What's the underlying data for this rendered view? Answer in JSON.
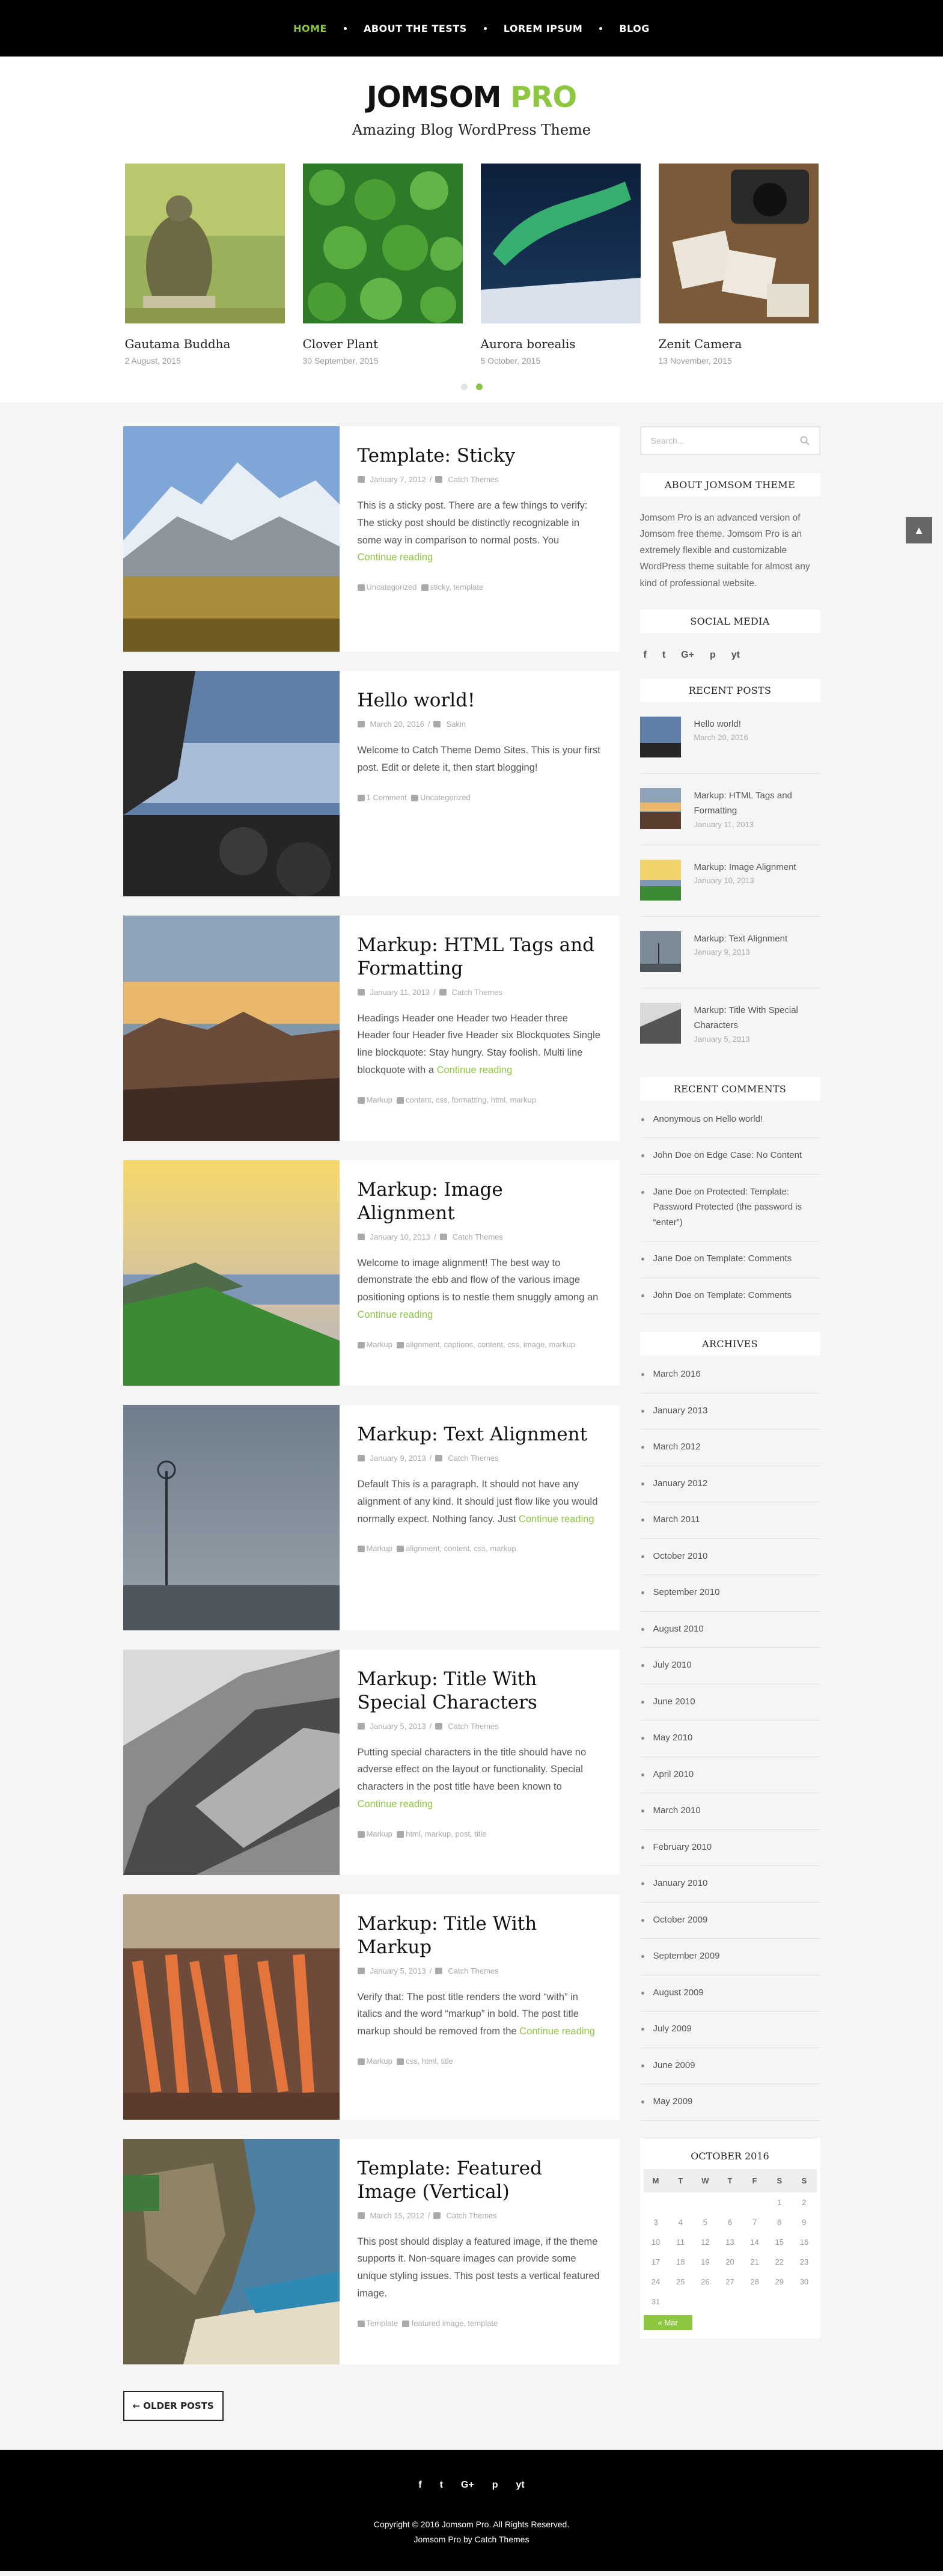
{
  "nav": {
    "items": [
      {
        "label": "HOME",
        "active": true
      },
      {
        "label": "ABOUT THE TESTS"
      },
      {
        "label": "LOREM IPSUM"
      },
      {
        "label": "BLOG"
      }
    ]
  },
  "header": {
    "title_main": "JOMSOM",
    "title_accent": "PRO",
    "description": "Amazing Blog WordPress Theme"
  },
  "featured": [
    {
      "title": "Gautama Buddha",
      "date": "2 August, 2015"
    },
    {
      "title": "Clover Plant",
      "date": "30 September, 2015"
    },
    {
      "title": "Aurora borealis",
      "date": "5 October, 2015"
    },
    {
      "title": "Zenit Camera",
      "date": "13 November, 2015"
    }
  ],
  "posts": [
    {
      "title": "Template: Sticky",
      "date": "January 7, 2012",
      "author": "Catch Themes",
      "excerpt": "This is a sticky post. There are a few things to verify: The sticky post should be distinctly recognizable in some way in comparison to normal posts. You",
      "more": "Continue reading",
      "cats": "Uncategorized",
      "tags": "sticky, template"
    },
    {
      "title": "Hello world!",
      "date": "March 20, 2016",
      "author": "Sakin",
      "excerpt": "Welcome to Catch Theme Demo Sites. This is your first post. Edit or delete it, then start blogging!",
      "more": "",
      "cats": "1 Comment",
      "tags": "Uncategorized"
    },
    {
      "title": "Markup: HTML Tags and Formatting",
      "date": "January 11, 2013",
      "author": "Catch Themes",
      "excerpt": "Headings Header one Header two Header three Header four Header five Header six Blockquotes Single line blockquote: Stay hungry. Stay foolish. Multi line blockquote with a",
      "more": "Continue reading",
      "cats": "Markup",
      "tags": "content, css, formatting, html, markup"
    },
    {
      "title": "Markup: Image Alignment",
      "date": "January 10, 2013",
      "author": "Catch Themes",
      "excerpt": "Welcome to image alignment! The best way to demonstrate the ebb and flow of the various image positioning options is to nestle them snuggly among an",
      "more": "Continue reading",
      "cats": "Markup",
      "tags": "alignment, captions, content, css, image, markup"
    },
    {
      "title": "Markup: Text Alignment",
      "date": "January 9, 2013",
      "author": "Catch Themes",
      "excerpt": "Default This is a paragraph. It should not have any alignment of any kind. It should just flow like you would normally expect. Nothing fancy. Just",
      "more": "Continue reading",
      "cats": "Markup",
      "tags": "alignment, content, css, markup"
    },
    {
      "title": "Markup: Title With Special Characters",
      "date": "January 5, 2013",
      "author": "Catch Themes",
      "excerpt": "Putting special characters in the title should have no adverse effect on the layout or functionality. Special characters in the post title have been known to",
      "more": "Continue reading",
      "cats": "Markup",
      "tags": "html, markup, post, title"
    },
    {
      "title": "Markup: Title With Markup",
      "date": "January 5, 2013",
      "author": "Catch Themes",
      "excerpt": "Verify that: The post title renders the word “with” in italics and the word “markup” in bold. The post title markup should be removed from the",
      "more": "Continue reading",
      "cats": "Markup",
      "tags": "css, html, title"
    },
    {
      "title": "Template: Featured Image (Vertical)",
      "date": "March 15, 2012",
      "author": "Catch Themes",
      "excerpt": "This post should display a featured image, if the theme supports it. Non-square images can provide some unique styling issues. This post tests a vertical featured image.",
      "more": "",
      "cats": "Template",
      "tags": "featured image, template"
    }
  ],
  "older_posts": "← OLDER POSTS",
  "sidebar": {
    "search_placeholder": "Search...",
    "about_title": "ABOUT JOMSOM THEME",
    "about_text": "Jomsom Pro is an advanced version of Jomsom free theme. Jomsom Pro is an extremely flexible and customizable WordPress theme suitable for almost any kind of professional website.",
    "social_title": "SOCIAL MEDIA",
    "social": [
      "f",
      "t",
      "G+",
      "p",
      "yt"
    ],
    "recent_title": "RECENT POSTS",
    "recent": [
      {
        "title": "Hello world!",
        "date": "March 20, 2016"
      },
      {
        "title": "Markup: HTML Tags and Formatting",
        "date": "January 11, 2013"
      },
      {
        "title": "Markup: Image Alignment",
        "date": "January 10, 2013"
      },
      {
        "title": "Markup: Text Alignment",
        "date": "January 9, 2013"
      },
      {
        "title": "Markup: Title With Special Characters",
        "date": "January 5, 2013"
      }
    ],
    "comments_title": "RECENT COMMENTS",
    "comments": [
      "Anonymous on Hello world!",
      "John Doe on Edge Case: No Content",
      "Jane Doe on Protected: Template: Password Protected (the password is “enter”)",
      "Jane Doe on Template: Comments",
      "John Doe on Template: Comments"
    ],
    "archives_title": "ARCHIVES",
    "archives": [
      "March 2016",
      "January 2013",
      "March 2012",
      "January 2012",
      "March 2011",
      "October 2010",
      "September 2010",
      "August 2010",
      "July 2010",
      "June 2010",
      "May 2010",
      "April 2010",
      "March 2010",
      "February 2010",
      "January 2010",
      "October 2009",
      "September 2009",
      "August 2009",
      "July 2009",
      "June 2009",
      "May 2009"
    ],
    "calendar": {
      "caption": "OCTOBER 2016",
      "days": [
        "M",
        "T",
        "W",
        "T",
        "F",
        "S",
        "S"
      ],
      "weeks": [
        [
          "",
          "",
          "",
          "",
          "",
          "1",
          "2"
        ],
        [
          "3",
          "4",
          "5",
          "6",
          "7",
          "8",
          "9"
        ],
        [
          "10",
          "11",
          "12",
          "13",
          "14",
          "15",
          "16"
        ],
        [
          "17",
          "18",
          "19",
          "20",
          "21",
          "22",
          "23"
        ],
        [
          "24",
          "25",
          "26",
          "27",
          "28",
          "29",
          "30"
        ],
        [
          "31",
          "",
          "",
          "",
          "",
          "",
          ""
        ]
      ],
      "prev": "« Mar"
    }
  },
  "footer": {
    "social": [
      "f",
      "t",
      "G+",
      "p",
      "yt"
    ],
    "copyright": "Copyright © 2016 Jomsom Pro. All Rights Reserved.",
    "credit": "Jomsom Pro by Catch Themes"
  },
  "colors": {
    "accent": "#8dc63f",
    "nav_bg": "#000000",
    "footer_bg": "#000000"
  }
}
